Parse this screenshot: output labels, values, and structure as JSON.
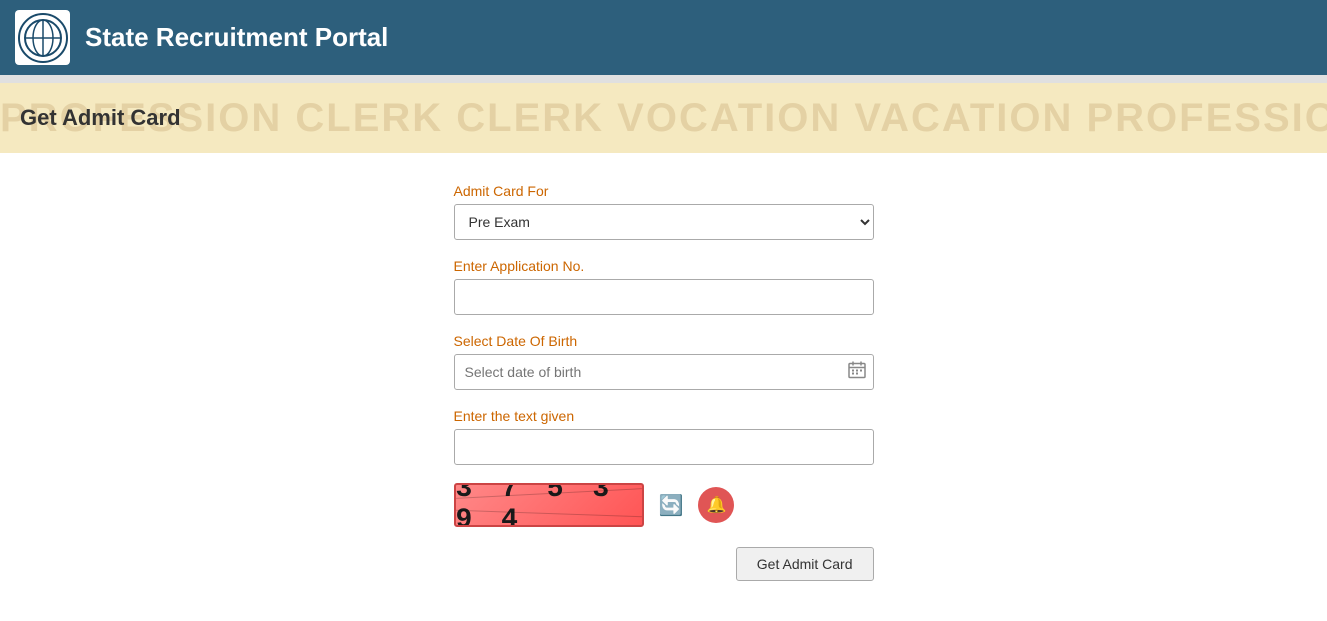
{
  "header": {
    "title": "State Recruitment Portal",
    "logo_symbol": "🌐"
  },
  "banner": {
    "title": "Get Admit Card",
    "bg_text": "PROFESSION   CLERK   CLERK   VOCATION   VACATION   PROFESSION   MISSION   MONEY   PROFESSION   PRO"
  },
  "form": {
    "admit_card_for_label": "Admit Card For",
    "admit_card_options": [
      {
        "value": "pre_exam",
        "label": "Pre Exam"
      }
    ],
    "admit_card_selected": "Pre Exam",
    "application_no_label": "Enter Application No.",
    "application_no_placeholder": "",
    "date_of_birth_label": "Select Date Of Birth",
    "date_of_birth_placeholder": "Select date of birth",
    "captcha_label": "Enter the text given",
    "captcha_placeholder": "",
    "captcha_text": "3 7 5 3 9 4",
    "submit_label": "Get Admit Card",
    "refresh_icon": "🔄",
    "audio_icon": "🔔"
  }
}
